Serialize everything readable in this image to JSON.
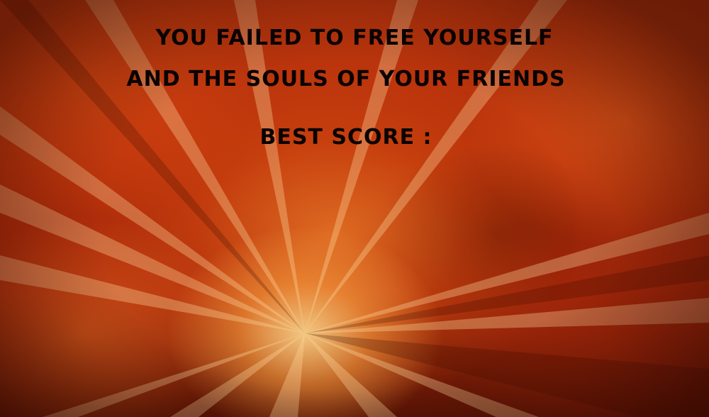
{
  "game_over": {
    "message_line1": "YOU FAILED TO FREE YOURSELF",
    "message_line2": "AND THE SOULS OF YOUR FRIENDS",
    "best_score_label": "BEST SCORE :",
    "best_score_value": ""
  },
  "background": {
    "description_icon": "fire-explosion-background",
    "colors": {
      "flame_red": "#b32e0a",
      "flame_orange": "#ff8c32",
      "hot_core": "#ffe196",
      "text": "#0a0302"
    }
  }
}
